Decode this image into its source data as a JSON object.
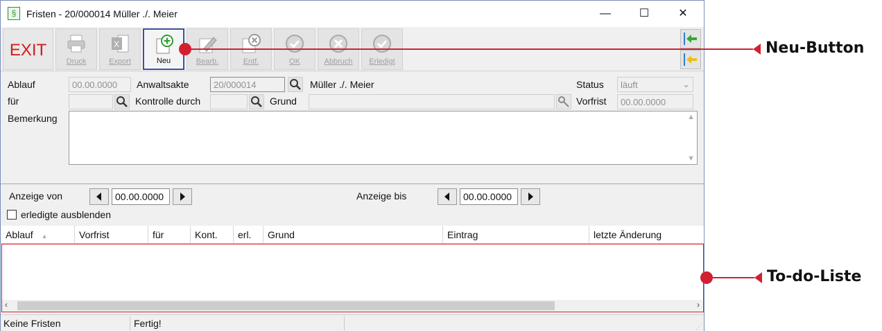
{
  "window": {
    "title": "Fristen - 20/000014 Müller ./. Meier",
    "controls": {
      "minimize": "—",
      "maximize": "☐",
      "close": "✕"
    }
  },
  "toolbar": {
    "exit_label": "EXIT",
    "buttons": [
      {
        "label": "Druck",
        "icon": "printer-icon"
      },
      {
        "label": "Export",
        "icon": "excel-icon"
      },
      {
        "label": "Neu",
        "icon": "plus-icon"
      },
      {
        "label": "Bearb.",
        "icon": "pencil-icon"
      },
      {
        "label": "Entf.",
        "icon": "delete-icon"
      },
      {
        "label": "OK",
        "icon": "check-icon"
      },
      {
        "label": "Abbruch",
        "icon": "cancel-icon"
      },
      {
        "label": "Erledigt",
        "icon": "done-icon"
      }
    ]
  },
  "form": {
    "ablauf_label": "Ablauf",
    "ablauf_value": "00.00.0000",
    "anwaltsakte_label": "Anwaltsakte",
    "anwaltsakte_value": "20/000014",
    "parties": "Müller ./. Meier",
    "status_label": "Status",
    "status_value": "läuft",
    "fuer_label": "für",
    "kontrolle_label": "Kontrolle durch",
    "grund_label": "Grund",
    "vorfrist_label": "Vorfrist",
    "vorfrist_value": "00.00.0000",
    "bemerkung_label": "Bemerkung"
  },
  "filter": {
    "anzeige_von_label": "Anzeige von",
    "anzeige_von_value": "00.00.0000",
    "anzeige_bis_label": "Anzeige bis",
    "anzeige_bis_value": "00.00.0000",
    "erledigte_label": "erledigte ausblenden"
  },
  "grid": {
    "columns": [
      "Ablauf",
      "Vorfrist",
      "für",
      "Kont.",
      "erl.",
      "Grund",
      "Eintrag",
      "letzte Änderung"
    ]
  },
  "statusbar": {
    "left": "Keine Fristen",
    "middle": "Fertig!"
  },
  "callouts": {
    "neu": "Neu-Button",
    "todo": "To-do-Liste",
    "color": "#d22030"
  }
}
